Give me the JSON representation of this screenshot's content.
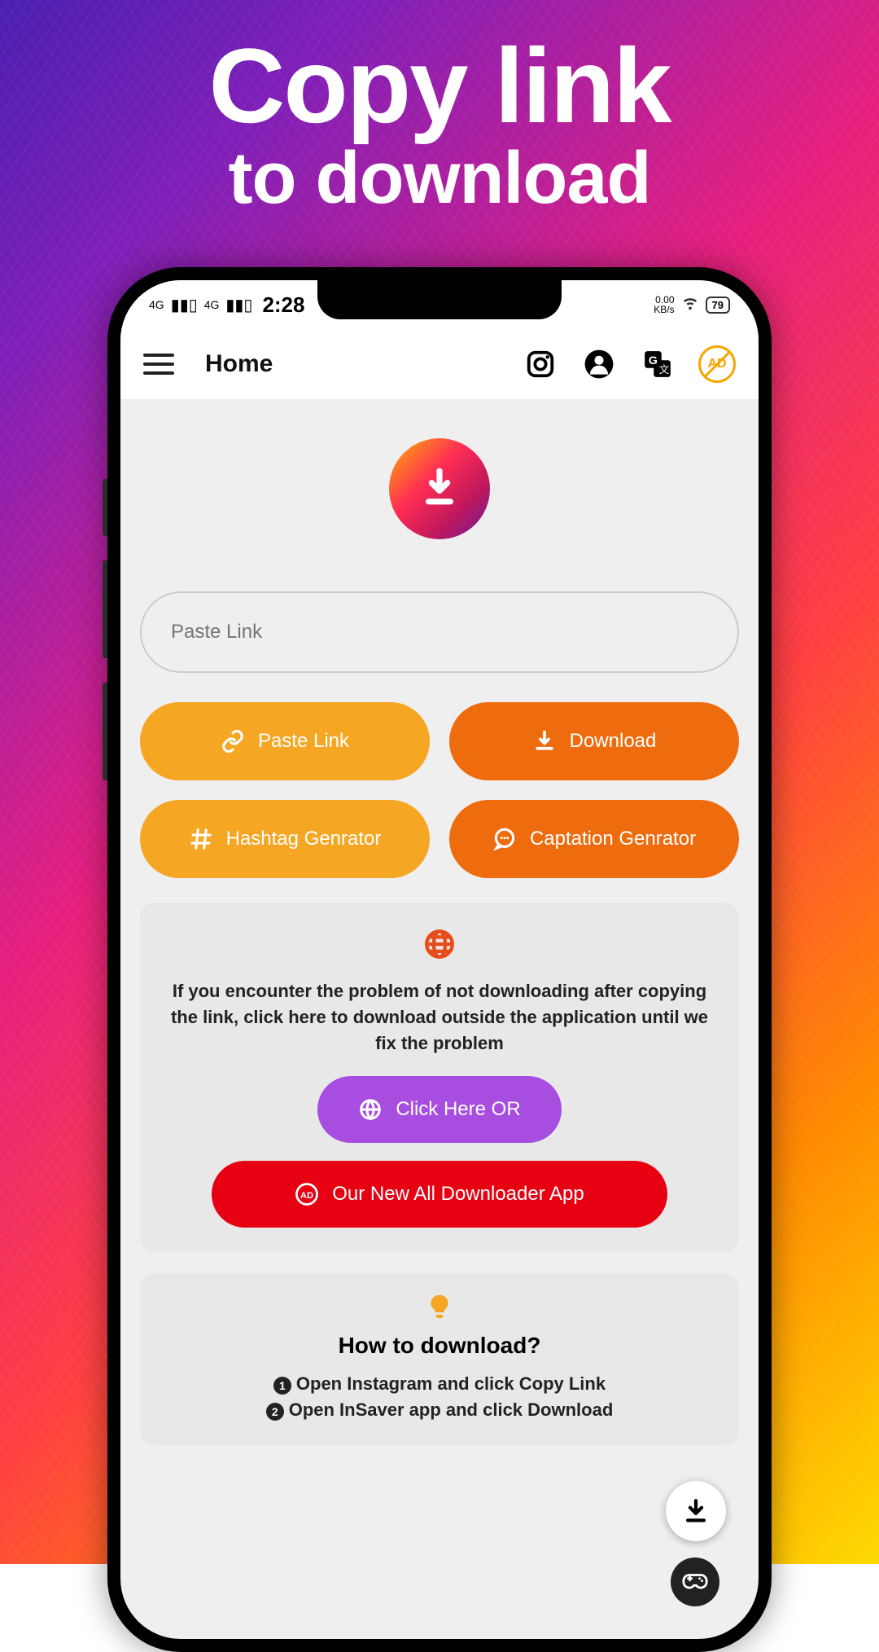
{
  "promo": {
    "line1": "Copy link",
    "line2": "to download"
  },
  "status_bar": {
    "signal1": "4G",
    "signal2": "4G",
    "time": "2:28",
    "net_speed": "0.00",
    "net_unit": "KB/s",
    "battery": "79"
  },
  "header": {
    "title": "Home"
  },
  "link_input": {
    "placeholder": "Paste Link",
    "value": ""
  },
  "buttons": {
    "paste_link": "Paste Link",
    "download": "Download",
    "hashtag": "Hashtag Genrator",
    "caption": "Captation Genrator"
  },
  "fallback_card": {
    "text": "If you encounter the problem of not downloading after copying the link, click here to download outside the application until we fix the problem",
    "click_here": "Click Here OR",
    "new_app": "Our New All Downloader App"
  },
  "howto": {
    "title": "How to download?",
    "step1": "Open Instagram and click Copy Link",
    "step2": "Open InSaver app and click Download"
  }
}
